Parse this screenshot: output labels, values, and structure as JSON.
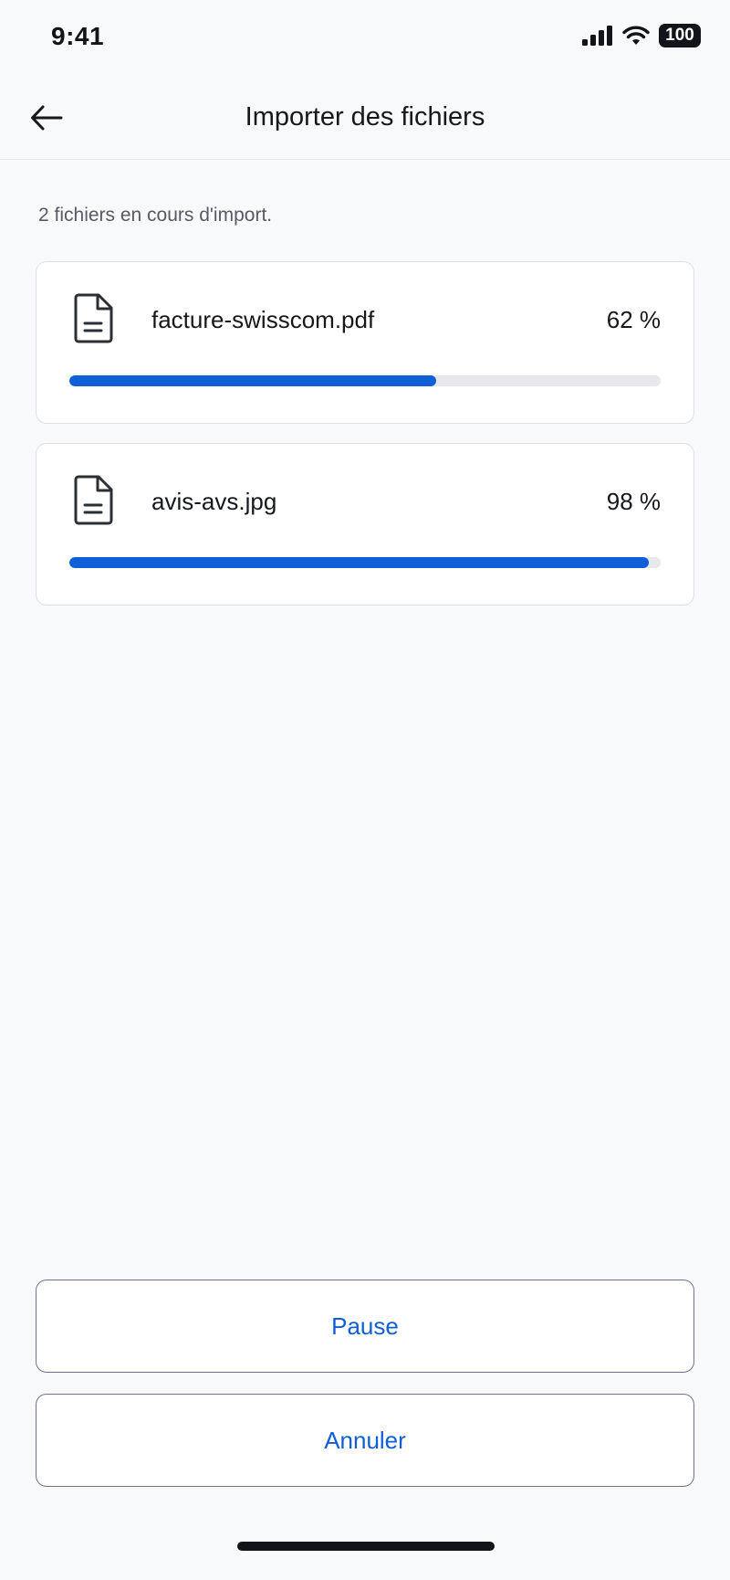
{
  "status_bar": {
    "time": "9:41",
    "battery": "100",
    "icons": [
      "cellular-signal-icon",
      "wifi-icon",
      "battery-icon"
    ]
  },
  "header": {
    "title": "Importer des fichiers",
    "back_icon": "arrow-left-icon"
  },
  "summary": "2 fichiers en cours d'import.",
  "files": [
    {
      "name": "facture-swisscom.pdf",
      "percent_label": "62 %",
      "progress": 0.62,
      "icon": "document-icon"
    },
    {
      "name": "avis-avs.jpg",
      "percent_label": "98 %",
      "progress": 0.98,
      "icon": "document-icon"
    }
  ],
  "actions": {
    "pause_label": "Pause",
    "cancel_label": "Annuler"
  },
  "colors": {
    "accent": "#0f5fd6",
    "track": "#e6e8eb",
    "background": "#f8f9fa",
    "card_border": "#dde1e6"
  }
}
